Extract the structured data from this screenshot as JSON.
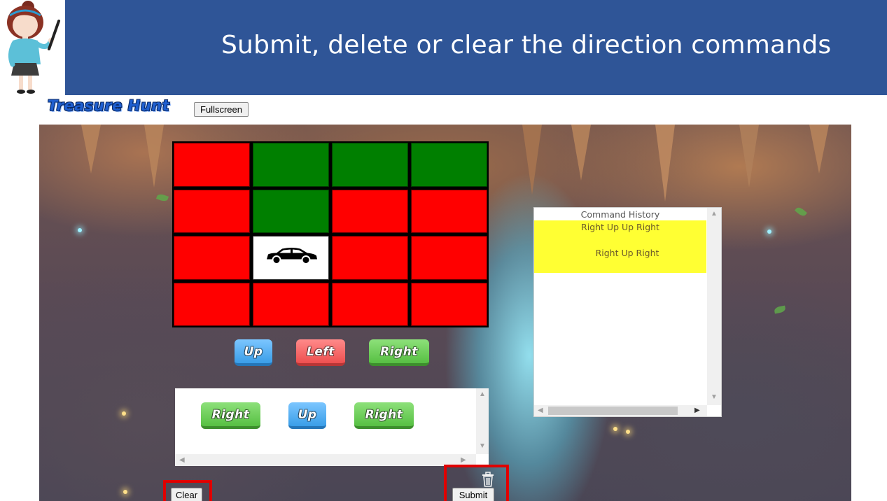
{
  "slide": {
    "title": "Submit, delete or clear the direction commands"
  },
  "app": {
    "logo_text": "Treasure Hunt",
    "fullscreen_label": "Fullscreen"
  },
  "board": {
    "rows": [
      [
        "red",
        "green",
        "green",
        "green"
      ],
      [
        "red",
        "green",
        "red",
        "red"
      ],
      [
        "red",
        "car",
        "red",
        "red"
      ],
      [
        "red",
        "red",
        "red",
        "red"
      ]
    ]
  },
  "direction_buttons": [
    {
      "label": "Up",
      "color": "blue"
    },
    {
      "label": "Left",
      "color": "red"
    },
    {
      "label": "Right",
      "color": "green"
    }
  ],
  "queue": [
    {
      "label": "Right",
      "color": "green"
    },
    {
      "label": "Up",
      "color": "blue"
    },
    {
      "label": "Right",
      "color": "green"
    }
  ],
  "history": {
    "title": "Command History",
    "entries": [
      "Right Up Up Right",
      "Right Up Right"
    ]
  },
  "controls": {
    "clear_label": "Clear",
    "submit_label": "Submit",
    "delete_icon": "trash-icon"
  },
  "colors": {
    "header": "#2f5597",
    "highlight_box": "#e00000",
    "history_highlight": "#ffff33",
    "cell_red": "#ff0000",
    "cell_green": "#007f00"
  }
}
